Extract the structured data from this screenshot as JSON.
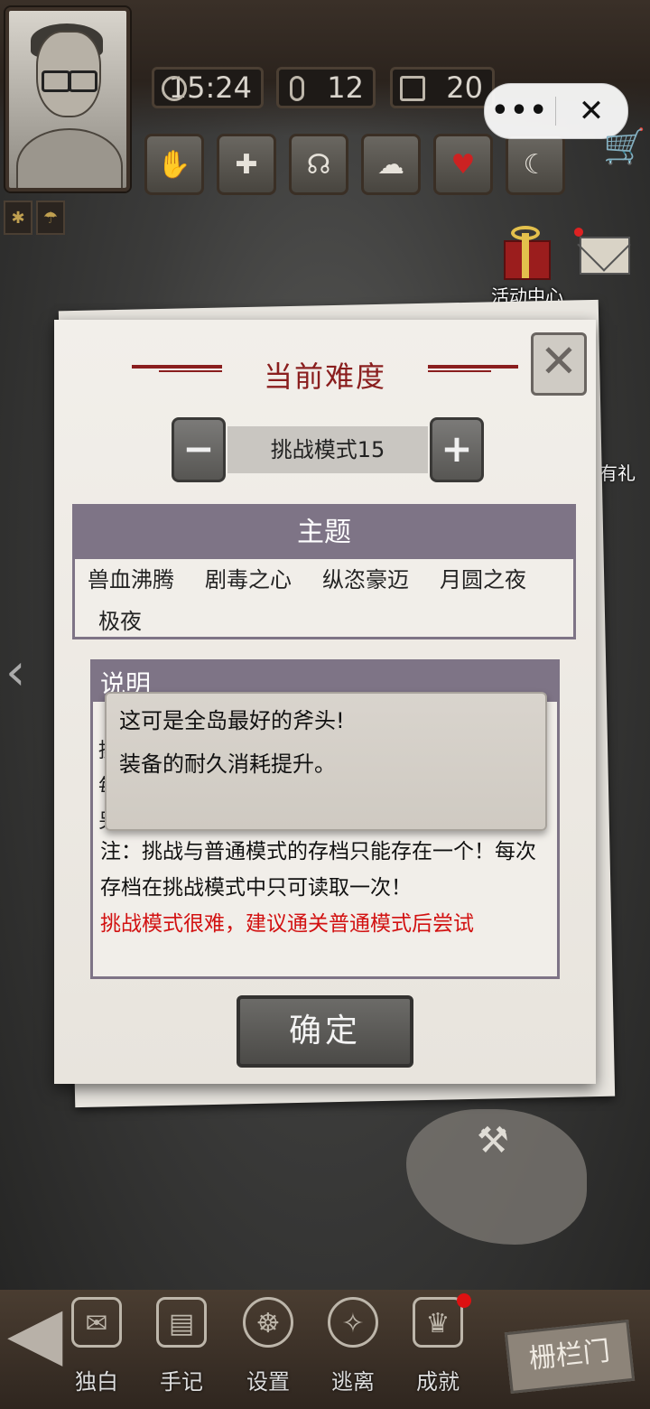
{
  "hud": {
    "time": "15:24",
    "temperature": "12",
    "day": "20",
    "status_icons": [
      "hand-icon",
      "medical-cross-icon",
      "stomach-icon",
      "brain-icon",
      "heart-icon",
      "moon-icon"
    ],
    "menu_dots": "•••",
    "close_symbol": "✕",
    "event_center_label": "活动中心",
    "side_gift_label": "有礼"
  },
  "dialog": {
    "title": "当前难度",
    "difficulty": {
      "minus": "−",
      "value": "挑战模式15",
      "plus": "+"
    },
    "theme": {
      "header": "主题",
      "items": [
        "兽血沸腾",
        "剧毒之心",
        "纵恣豪迈",
        "月圆之夜",
        "极夜"
      ]
    },
    "description": {
      "header": "说明",
      "partial_lines": [
        "挑",
        "每",
        "另"
      ],
      "note": "注：挑战与普通模式的存档只能存在一个！每次存档在挑战模式中只可读取一次！",
      "warning": "挑战模式很难，建议通关普通模式后尝试",
      "warning_color": "#d21111"
    },
    "tooltip": {
      "line1": "这可是全岛最好的斧头!",
      "line2": "装备的耐久消耗提升。"
    },
    "confirm": "确定",
    "title_color": "#8a1e1e"
  },
  "bottom_nav": {
    "items": [
      {
        "label": "独白",
        "icon": "scroll-icon"
      },
      {
        "label": "手记",
        "icon": "notebook-icon"
      },
      {
        "label": "设置",
        "icon": "ship-wheel-icon"
      },
      {
        "label": "逃离",
        "icon": "compass-icon"
      },
      {
        "label": "成就",
        "icon": "trophy-icon"
      }
    ],
    "gate_label": "栅栏门"
  }
}
